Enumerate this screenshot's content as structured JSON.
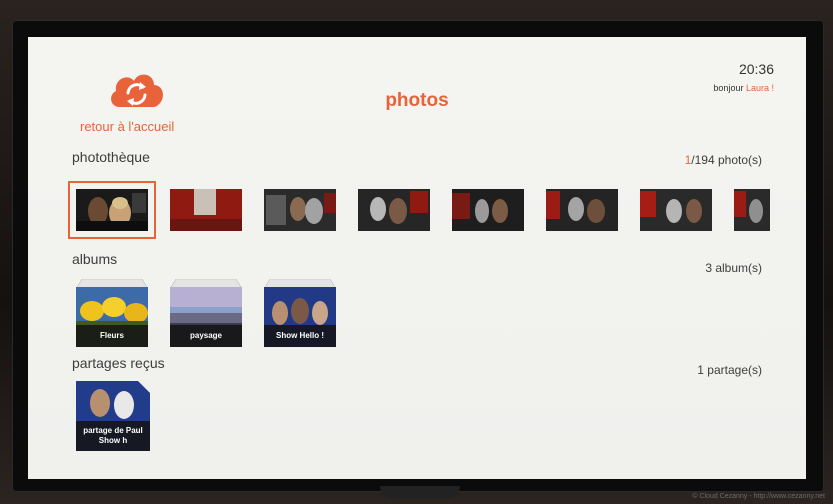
{
  "header": {
    "home_link": "retour à l'accueil",
    "title": "photos",
    "time": "20:36",
    "greeting": "bonjour",
    "user_name": "Laura !"
  },
  "library": {
    "title": "photothèque",
    "current": "1",
    "total": "/194 photo(s)",
    "thumbnails": [
      "thumb-1",
      "thumb-2",
      "thumb-3",
      "thumb-4",
      "thumb-5",
      "thumb-6",
      "thumb-7",
      "thumb-8"
    ]
  },
  "albums": {
    "title": "albums",
    "count": "3 album(s)",
    "items": [
      {
        "label": "Fleurs"
      },
      {
        "label": "paysage"
      },
      {
        "label": "Show Hello !"
      }
    ]
  },
  "shares": {
    "title": "partages reçus",
    "count": "1 partage(s)",
    "items": [
      {
        "label": "partage de Paul Show h"
      }
    ]
  },
  "footer": {
    "watermark": "© Cloud Cezanny - http://www.cezanny.net"
  },
  "colors": {
    "accent": "#e8633a",
    "background": "#f0f0ed"
  }
}
